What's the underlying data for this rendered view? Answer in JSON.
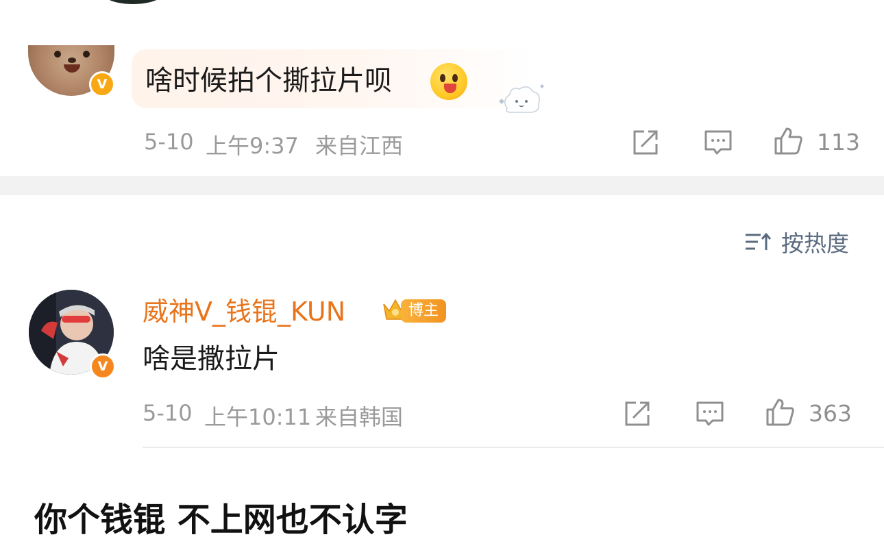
{
  "comments": [
    {
      "text": "啥时候拍个撕拉片呗",
      "emoji": "tongue-out-face-emoji",
      "date": "5-10",
      "time": "上午9:37",
      "location": "来自江西",
      "likes": "113",
      "verified_badge": "V",
      "verified_color": "#f7a814"
    },
    {
      "username": "威神V_钱锟_KUN",
      "badge": "博主",
      "text": "啥是撒拉片",
      "date": "5-10",
      "time": "上午10:11",
      "location": "来自韩国",
      "likes": "363",
      "verified_badge": "V",
      "verified_color": "#f5871f",
      "username_color": "#e8741c"
    }
  ],
  "sort": {
    "label": "按热度",
    "icon": "sort-icon"
  },
  "actions": [
    "share-icon",
    "comment-icon",
    "like-icon"
  ],
  "caption": "你个钱锟 不上网也不认字"
}
